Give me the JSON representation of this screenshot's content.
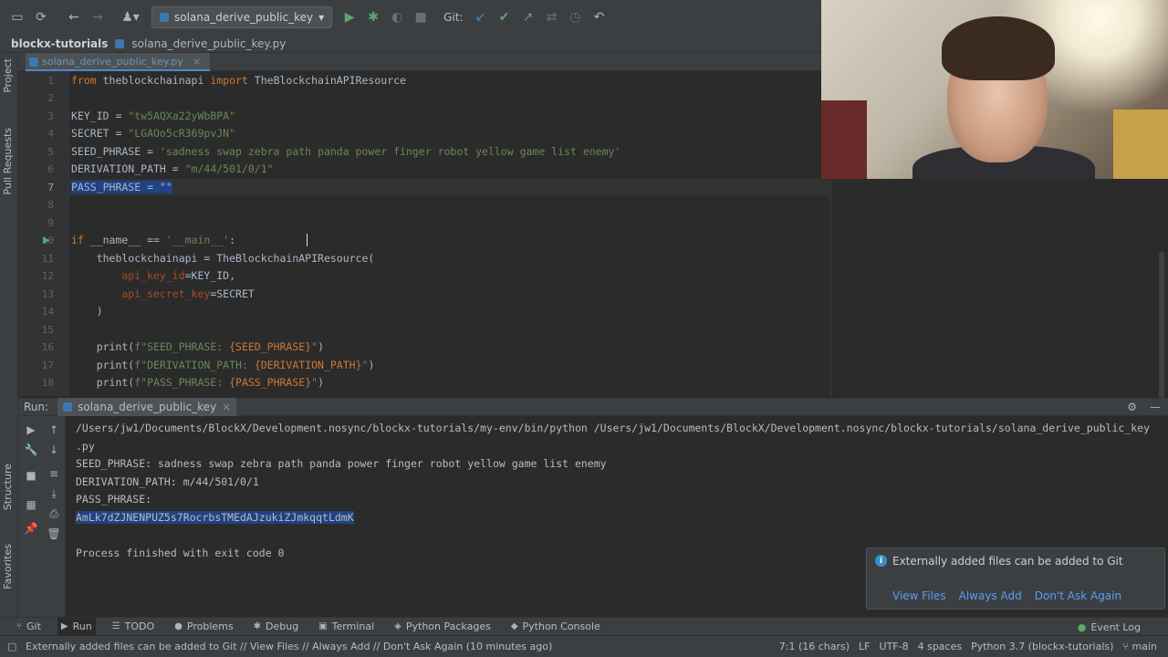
{
  "toolbar": {
    "run_config": "solana_derive_public_key",
    "git_label": "Git:"
  },
  "breadcrumb": {
    "project": "blockx-tutorials",
    "file": "solana_derive_public_key.py"
  },
  "left_strip": {
    "project": "Project",
    "pull_requests": "Pull Requests",
    "structure": "Structure",
    "favorites": "Favorites"
  },
  "editor": {
    "tab_label": "solana_derive_public_key.py",
    "line_numbers": [
      "1",
      "2",
      "3",
      "4",
      "5",
      "6",
      "7",
      "8",
      "9",
      "10",
      "11",
      "12",
      "13",
      "14",
      "15",
      "16",
      "17",
      "18"
    ],
    "lines": {
      "l1_kw1": "from",
      "l1_mod": " theblockchainapi ",
      "l1_kw2": "import",
      "l1_cls": " TheBlockchainAPIResource",
      "l3_name": "KEY_ID = ",
      "l3_val": "\"tw5AQXa22yWbBPA\"",
      "l4_name": "SECRET = ",
      "l4_val": "\"LGAOo5cR369pvJN\"",
      "l5_name": "SEED_PHRASE = ",
      "l5_val": "'sadness swap zebra path panda power finger robot yellow game list enemy'",
      "l6_name": "DERIVATION_PATH = ",
      "l6_val": "\"m/44/501/0/1\"",
      "l7_sel": "PASS_PHRASE = \"\"",
      "l10_kw": "if",
      "l10_a": " __name__ == ",
      "l10_str": "'__main__'",
      "l10_b": ":",
      "l11_a": "    theblockchainapi = TheBlockchainAPIResource(",
      "l12_param": "        api_key_id",
      "l12_val": "=KEY_ID,",
      "l13_param": "        api_secret_key",
      "l13_val": "=SECRET",
      "l14": "    )",
      "l16_a": "    print(",
      "l16_str": "f\"SEED_PHRASE: ",
      "l16_b": "{SEED_PHRASE}",
      "l16_c": "\"",
      "l16_d": ")",
      "l17_a": "    print(",
      "l17_str": "f\"DERIVATION_PATH: ",
      "l17_b": "{DERIVATION_PATH}",
      "l17_c": "\"",
      "l17_d": ")",
      "l18_a": "    print(",
      "l18_str": "f\"PASS_PHRASE: ",
      "l18_b": "{PASS_PHRASE}",
      "l18_c": "\"",
      "l18_d": ")"
    }
  },
  "run_panel": {
    "label": "Run:",
    "tab": "solana_derive_public_key",
    "console": [
      "/Users/jw1/Documents/BlockX/Development.nosync/blockx-tutorials/my-env/bin/python /Users/jw1/Documents/BlockX/Development.nosync/blockx-tutorials/solana_derive_public_key",
      ".py",
      "SEED_PHRASE: sadness swap zebra path panda power finger robot yellow game list enemy",
      "DERIVATION_PATH: m/44/501/0/1",
      "PASS_PHRASE: ",
      "AmLk7dZJNENPUZ5s7RocrbsTMEdAJzukiZJmkqqtLdmK",
      "",
      "Process finished with exit code 0"
    ]
  },
  "notification": {
    "message": "Externally added files can be added to Git",
    "actions": [
      "View Files",
      "Always Add",
      "Don't Ask Again"
    ]
  },
  "tool_windows": {
    "git": "Git",
    "run": "Run",
    "todo": "TODO",
    "problems": "Problems",
    "debug": "Debug",
    "terminal": "Terminal",
    "python_packages": "Python Packages",
    "python_console": "Python Console",
    "event_log": "Event Log"
  },
  "status_bar": {
    "message": "Externally added files can be added to Git // View Files // Always Add // Don't Ask Again (10 minutes ago)",
    "position": "7:1 (16 chars)",
    "line_sep": "LF",
    "encoding": "UTF-8",
    "indent": "4 spaces",
    "interpreter": "Python 3.7 (blockx-tutorials)",
    "branch": "main"
  },
  "colors": {
    "keyword": "#cc7832",
    "string": "#6a8759",
    "param": "#aa4926",
    "selection": "#214283",
    "link": "#589df6"
  }
}
